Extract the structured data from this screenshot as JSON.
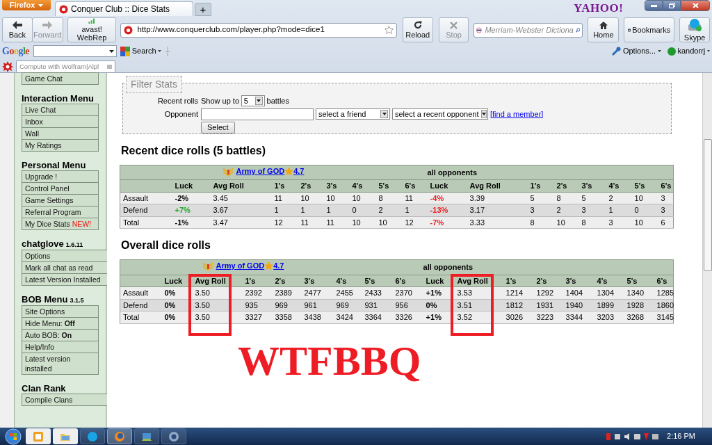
{
  "browser": {
    "menu_button": "Firefox",
    "tabs": [
      {
        "title": "Conquer Club :: Dice Stats",
        "selected": true
      }
    ],
    "new_tab": "+",
    "logo": "YAHOO!",
    "nav_buttons": [
      {
        "label": "Back",
        "kind": "back",
        "disabled": false
      },
      {
        "label": "Forward",
        "kind": "forward",
        "disabled": true
      },
      {
        "label": "avast! WebRep",
        "kind": "avast",
        "disabled": false
      }
    ],
    "url": "http://www.conquerclub.com/player.php?mode=dice1",
    "page_buttons": [
      {
        "label": "Reload",
        "kind": "reload",
        "disabled": false
      },
      {
        "label": "Stop",
        "kind": "stop",
        "disabled": true
      }
    ],
    "search_placeholder": "Merriam-Webster Dictiona",
    "right_buttons": [
      {
        "label": "Home",
        "kind": "home"
      },
      {
        "label": "Bookmarks",
        "kind": "bookmarks"
      },
      {
        "label": "Skype",
        "kind": "skype"
      }
    ]
  },
  "google_bar": {
    "logo": "Google",
    "search": "Search",
    "options": "Options...",
    "user": "kandorrj"
  },
  "wolfram_bar": {
    "placeholder": "Compute with Wolfram|Alpl"
  },
  "sidebar": [
    {
      "items": [
        {
          "label": "Game Chat"
        }
      ]
    },
    {
      "title": "Interaction Menu",
      "items": [
        {
          "label": "Live Chat"
        },
        {
          "label": "Inbox"
        },
        {
          "label": "Wall"
        },
        {
          "label": "My Ratings"
        }
      ]
    },
    {
      "title": "Personal Menu",
      "items": [
        {
          "label": "Upgrade !"
        },
        {
          "label": "Control Panel"
        },
        {
          "label": "Game Settings"
        },
        {
          "label": "Referral Program"
        },
        {
          "label": "My Dice Stats",
          "badge": "NEW!"
        }
      ]
    },
    {
      "title": "chatglove",
      "version": "1.6.11",
      "wide": true,
      "items": [
        {
          "label": "Options"
        },
        {
          "label": "Mark all chat as read"
        },
        {
          "label": "Latest Version Installed"
        }
      ]
    },
    {
      "title": "BOB Menu",
      "version": "3.1.5",
      "wide": false,
      "items": [
        {
          "label": "Site Options"
        },
        {
          "label": "Hide Menu: **Off**"
        },
        {
          "label": "Auto BOB: **On**"
        },
        {
          "label": "Help/Info"
        },
        {
          "label": "Latest version installed"
        }
      ]
    },
    {
      "title": "Clan Rank",
      "wide": true,
      "items": [
        {
          "label": "Compile Clans"
        }
      ]
    }
  ],
  "filter": {
    "legend": "Filter Stats",
    "recent_label": "Recent rolls",
    "show_prefix": "Show up to",
    "show_value": "5",
    "show_suffix": "battles",
    "opponent_label": "Opponent",
    "friend_select": "select a friend",
    "opponent_select": "select a recent opponent",
    "find_link": "[find a member]",
    "button": "Select"
  },
  "tables": [
    {
      "title": "Recent dice rolls (5 battles)",
      "player": {
        "name": "Army of GOD",
        "rating": "4.7"
      },
      "opponents": "all opponents",
      "columns": [
        {
          "label": "Luck",
          "circled": false
        },
        {
          "label": "Avg Roll",
          "circled": false
        },
        {
          "label": "1's",
          "circled": false
        },
        {
          "label": "2's",
          "circled": false
        },
        {
          "label": "3's",
          "circled": false
        },
        {
          "label": "4's",
          "circled": false
        },
        {
          "label": "5's",
          "circled": false
        },
        {
          "label": "6's",
          "circled": false
        },
        {
          "label": "Luck",
          "circled": false
        },
        {
          "label": "Avg Roll",
          "circled": false
        },
        {
          "label": "1's",
          "circled": false
        },
        {
          "label": "2's",
          "circled": false
        },
        {
          "label": "3's",
          "circled": false
        },
        {
          "label": "4's",
          "circled": false
        },
        {
          "label": "5's",
          "circled": false
        },
        {
          "label": "6's",
          "circled": false
        }
      ],
      "rows": [
        {
          "label": "Assault",
          "player": {
            "luck": {
              "text": "-2%",
              "color": "#000000"
            },
            "avg": "3.45",
            "counts": [
              "11",
              "10",
              "10",
              "10",
              "8",
              "11"
            ]
          },
          "opponents": {
            "luck": {
              "text": "-4%",
              "color": "#ee1c1c"
            },
            "avg": "3.39",
            "counts": [
              "5",
              "8",
              "5",
              "2",
              "10",
              "3"
            ]
          }
        },
        {
          "label": "Defend",
          "player": {
            "luck": {
              "text": "+7%",
              "color": "#22a32a"
            },
            "avg": "3.67",
            "counts": [
              "1",
              "1",
              "1",
              "0",
              "2",
              "1"
            ]
          },
          "opponents": {
            "luck": {
              "text": "-13%",
              "color": "#ee1c1c"
            },
            "avg": "3.17",
            "counts": [
              "3",
              "2",
              "3",
              "1",
              "0",
              "3"
            ]
          }
        },
        {
          "label": "Total",
          "player": {
            "luck": {
              "text": "-1%",
              "color": "#000000"
            },
            "avg": "3.47",
            "counts": [
              "12",
              "11",
              "11",
              "10",
              "10",
              "12"
            ]
          },
          "opponents": {
            "luck": {
              "text": "-7%",
              "color": "#ee1c1c"
            },
            "avg": "3.33",
            "counts": [
              "8",
              "10",
              "8",
              "3",
              "10",
              "6"
            ]
          }
        }
      ]
    },
    {
      "title": "Overall dice rolls",
      "player": {
        "name": "Army of GOD",
        "rating": "4.7"
      },
      "opponents": "all opponents",
      "columns": [
        {
          "label": "Luck",
          "circled": false
        },
        {
          "label": "Avg Roll",
          "circled": true
        },
        {
          "label": "1's",
          "circled": false
        },
        {
          "label": "2's",
          "circled": false
        },
        {
          "label": "3's",
          "circled": false
        },
        {
          "label": "4's",
          "circled": false
        },
        {
          "label": "5's",
          "circled": false
        },
        {
          "label": "6's",
          "circled": false
        },
        {
          "label": "Luck",
          "circled": false
        },
        {
          "label": "Avg Roll",
          "circled": true
        },
        {
          "label": "1's",
          "circled": false
        },
        {
          "label": "2's",
          "circled": false
        },
        {
          "label": "3's",
          "circled": false
        },
        {
          "label": "4's",
          "circled": false
        },
        {
          "label": "5's",
          "circled": false
        },
        {
          "label": "6's",
          "circled": false
        }
      ],
      "rows": [
        {
          "label": "Assault",
          "player": {
            "luck": {
              "text": "0%",
              "color": "#000000"
            },
            "avg": "3.50",
            "counts": [
              "2392",
              "2389",
              "2477",
              "2455",
              "2433",
              "2370"
            ]
          },
          "opponents": {
            "luck": {
              "text": "+1%",
              "color": "#000000"
            },
            "avg": "3.53",
            "counts": [
              "1214",
              "1292",
              "1404",
              "1304",
              "1340",
              "1285"
            ]
          }
        },
        {
          "label": "Defend",
          "player": {
            "luck": {
              "text": "0%",
              "color": "#000000"
            },
            "avg": "3.50",
            "counts": [
              "935",
              "969",
              "961",
              "969",
              "931",
              "956"
            ]
          },
          "opponents": {
            "luck": {
              "text": "0%",
              "color": "#000000"
            },
            "avg": "3.51",
            "counts": [
              "1812",
              "1931",
              "1940",
              "1899",
              "1928",
              "1860"
            ]
          }
        },
        {
          "label": "Total",
          "player": {
            "luck": {
              "text": "0%",
              "color": "#000000"
            },
            "avg": "3.50",
            "counts": [
              "3327",
              "3358",
              "3438",
              "3424",
              "3364",
              "3326"
            ]
          },
          "opponents": {
            "luck": {
              "text": "+1%",
              "color": "#000000"
            },
            "avg": "3.52",
            "counts": [
              "3026",
              "3223",
              "3344",
              "3203",
              "3268",
              "3145"
            ]
          }
        }
      ]
    }
  ],
  "annotation": {
    "text": "WTFBBQ"
  },
  "taskbar": {
    "apps": [
      {
        "kind": "outlook",
        "active": false
      },
      {
        "kind": "folder",
        "active": false
      },
      {
        "kind": "skype",
        "active": false
      },
      {
        "kind": "firefox",
        "active": true
      },
      {
        "kind": "network",
        "active": false
      },
      {
        "kind": "itunes",
        "active": false
      }
    ],
    "clock": "2:16 PM"
  }
}
